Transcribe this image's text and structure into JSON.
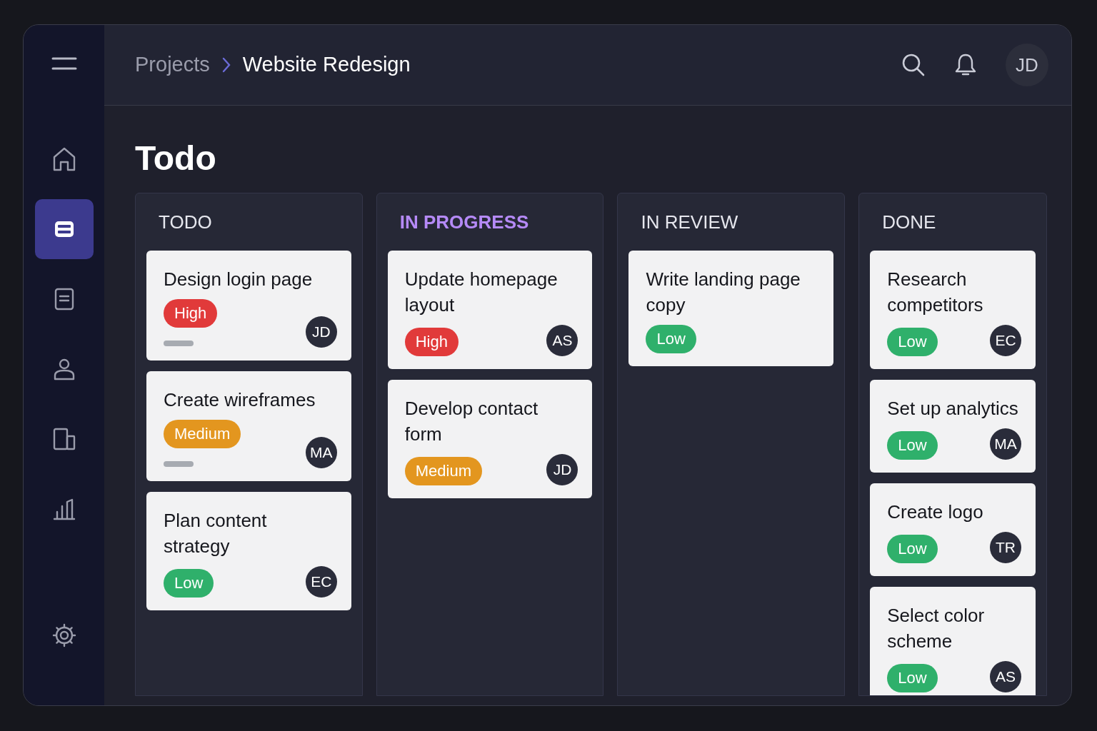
{
  "sidebar": {
    "items": [
      {
        "kind": "home",
        "selected": false
      },
      {
        "kind": "board",
        "selected": true
      },
      {
        "kind": "document",
        "selected": false
      },
      {
        "kind": "user",
        "selected": false
      },
      {
        "kind": "devices",
        "selected": false
      },
      {
        "kind": "chart",
        "selected": false
      }
    ],
    "footer_item": {
      "kind": "settings",
      "selected": false
    }
  },
  "breadcrumb": [
    "Projects",
    "Website Redesign"
  ],
  "header": {
    "avatar": "JD"
  },
  "page_title": "Todo",
  "columns": [
    {
      "title": "TODO",
      "highlighted": false,
      "cards": [
        {
          "title": "Design login page",
          "priority": "High",
          "kind": "high",
          "bar": true,
          "assignee": "JD"
        },
        {
          "title": "Create wireframes",
          "priority": "Medium",
          "kind": "medium",
          "bar": true,
          "assignee": "MA"
        },
        {
          "title": "Plan content strategy",
          "priority": "Low",
          "kind": "low",
          "bar": false,
          "assignee": "EC"
        }
      ]
    },
    {
      "title": "IN PROGRESS",
      "highlighted": true,
      "cards": [
        {
          "title": "Update homepage layout",
          "priority": "High",
          "kind": "high",
          "bar": false,
          "assignee": "AS"
        },
        {
          "title": "Develop contact form",
          "priority": "Medium",
          "kind": "medium",
          "bar": false,
          "assignee": "JD"
        }
      ]
    },
    {
      "title": "IN REVIEW",
      "highlighted": false,
      "cards": [
        {
          "title": "Write landing page copy",
          "priority": "Low",
          "kind": "low",
          "bar": false
        }
      ]
    },
    {
      "title": "DONE",
      "highlighted": false,
      "cards": [
        {
          "title": "Research competitors",
          "priority": "Low",
          "kind": "low",
          "bar": false,
          "assignee": "EC"
        },
        {
          "title": "Set up analytics",
          "priority": "Low",
          "kind": "low",
          "bar": false,
          "assignee": "MA"
        },
        {
          "title": "Create logo",
          "priority": "Low",
          "kind": "low",
          "bar": false,
          "assignee": "TR"
        },
        {
          "title": "Select color scheme",
          "priority": "Low",
          "kind": "low",
          "bar": false,
          "assignee": "AS"
        }
      ]
    }
  ]
}
